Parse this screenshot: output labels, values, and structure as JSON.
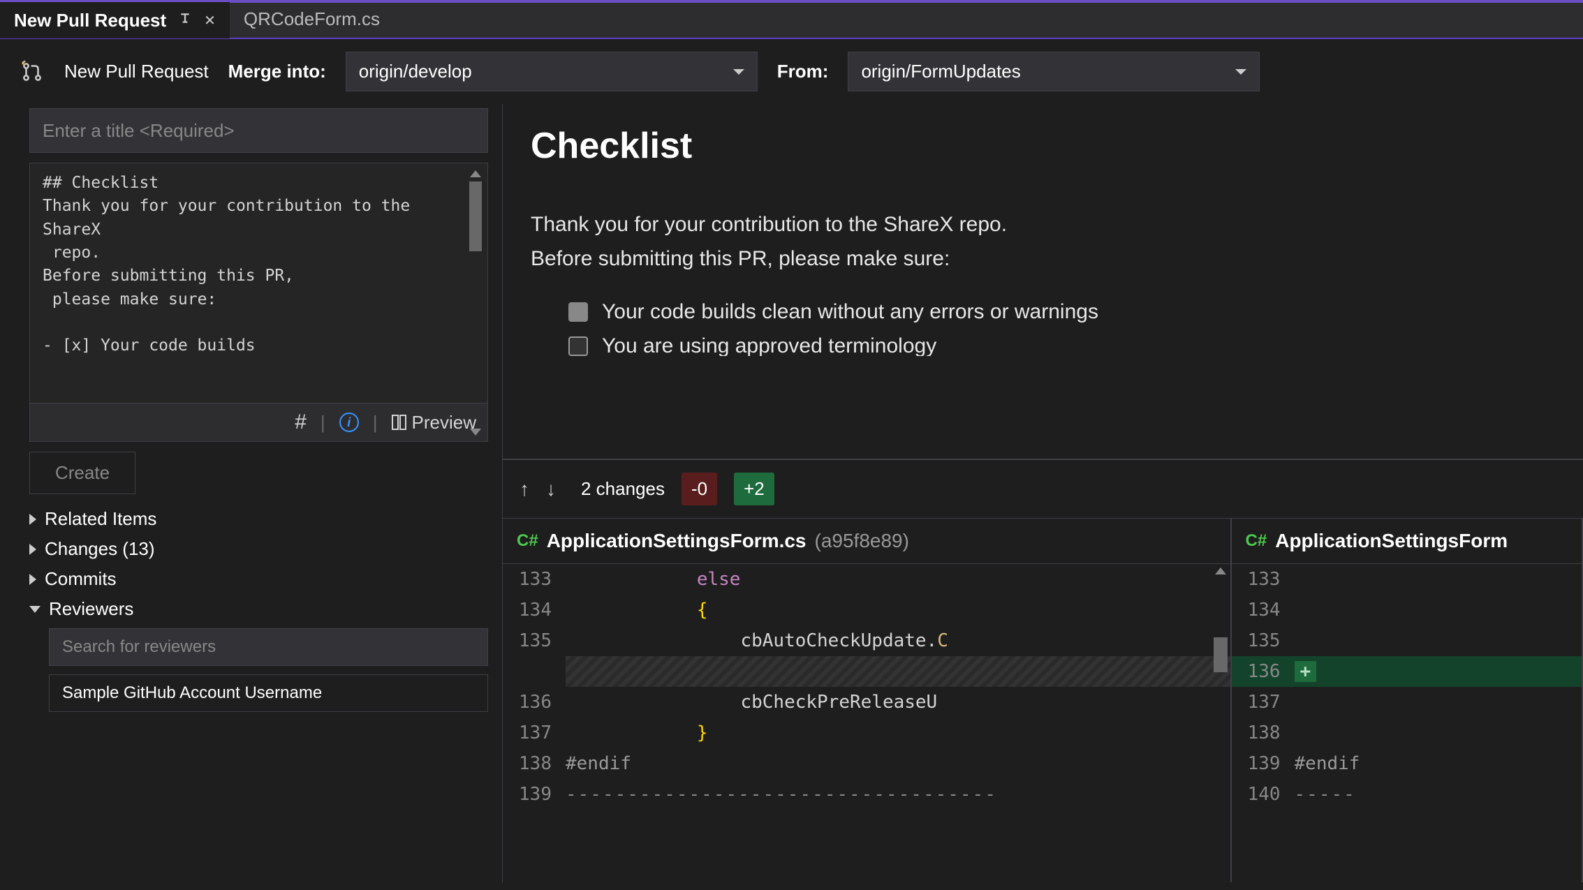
{
  "tabs": {
    "active": "New Pull Request",
    "inactive": "QRCodeForm.cs"
  },
  "branchbar": {
    "title": "New Pull Request",
    "merge_label": "Merge into:",
    "merge_value": "origin/develop",
    "from_label": "From:",
    "from_value": "origin/FormUpdates"
  },
  "title_placeholder": "Enter a title <Required>",
  "description_text": "## Checklist\nThank you for your contribution to the ShareX\n repo.\nBefore submitting this PR,\n please make sure:\n\n- [x] Your code builds",
  "toolbar": {
    "preview": "Preview"
  },
  "create_label": "Create",
  "tree": {
    "related": "Related Items",
    "changes": "Changes (13)",
    "commits": "Commits",
    "reviewers": "Reviewers"
  },
  "reviewer_search": "Search for reviewers",
  "reviewer_sample": "Sample GitHub Account Username",
  "preview": {
    "heading": "Checklist",
    "p1": "Thank you for your contribution to the ShareX repo.",
    "p2": "Before submitting this PR, please make sure:",
    "item1": "Your code builds clean without any errors or warnings",
    "item2": "You are using approved terminology"
  },
  "diff": {
    "changes": "2 changes",
    "minus": "-0",
    "plus": "+2",
    "file_left": "ApplicationSettingsForm.cs",
    "hash": "(a95f8e89)",
    "file_right": "ApplicationSettingsForm",
    "left_lines": [
      {
        "n": "133",
        "html": "            <span class='kw'>else</span>"
      },
      {
        "n": "134",
        "html": "            <span class='brace'>{</span>"
      },
      {
        "n": "135",
        "html": "                cbAutoCheckUpdate.<span class='goldline'>C</span>"
      },
      {
        "n": "",
        "html": "SLOT"
      },
      {
        "n": "136",
        "html": "                cbCheckPreReleaseU"
      },
      {
        "n": "137",
        "html": "            <span class='brace'>}</span>"
      },
      {
        "n": "138",
        "html": "<span class='dir'>#endif</span>"
      },
      {
        "n": "139",
        "html": "<span class='dashes'>-----------------------------------</span>"
      }
    ],
    "right_lines": [
      {
        "n": "133",
        "html": ""
      },
      {
        "n": "134",
        "html": ""
      },
      {
        "n": "135",
        "html": ""
      },
      {
        "n": "136",
        "html": "ADD"
      },
      {
        "n": "137",
        "html": ""
      },
      {
        "n": "138",
        "html": ""
      },
      {
        "n": "139",
        "html": "<span class='dir'>#endif</span>"
      },
      {
        "n": "140",
        "html": "<span class='dashes'>-----</span>"
      }
    ]
  }
}
